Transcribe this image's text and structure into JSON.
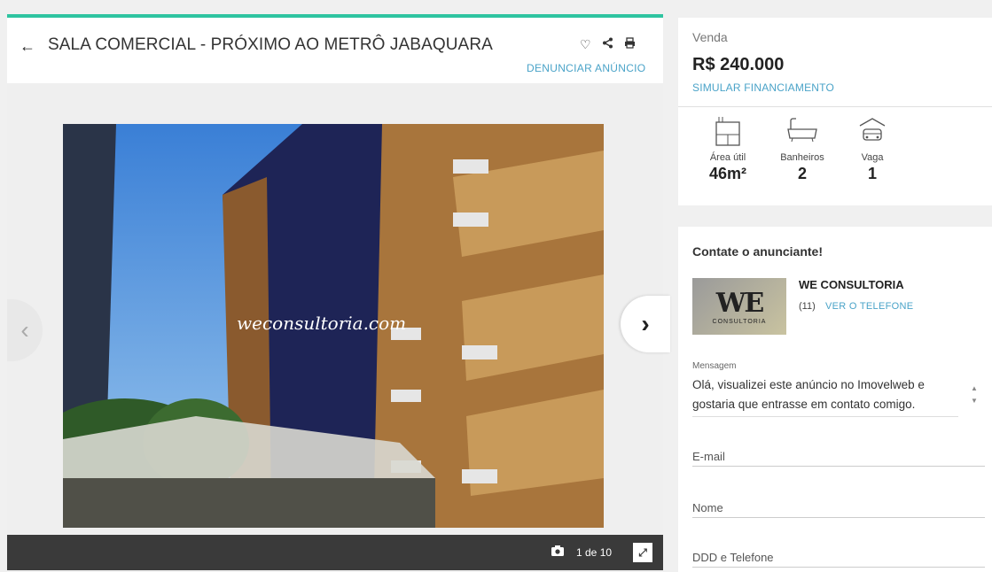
{
  "listing": {
    "title": "SALA COMERCIAL - PRÓXIMO AO METRÔ JABAQUARA",
    "report_label": "DENUNCIAR ANÚNCIO",
    "icons": [
      "heart-icon",
      "share-icon",
      "print-icon"
    ]
  },
  "gallery": {
    "watermark": "weconsultoria.com",
    "counter": "1 de 10",
    "current_photo": 1,
    "total_photos": 10
  },
  "pricing": {
    "type_label": "Venda",
    "price": "R$ 240.000",
    "financing_label": "SIMULAR FINANCIAMENTO"
  },
  "features": [
    {
      "icon": "area-icon",
      "label": "Área útil",
      "value": "46m²"
    },
    {
      "icon": "bathtub-icon",
      "label": "Banheiros",
      "value": "2"
    },
    {
      "icon": "car-icon",
      "label": "Vaga",
      "value": "1"
    }
  ],
  "contact": {
    "title": "Contate o anunciante!",
    "company": "WE CONSULTORIA",
    "logo_text": "WE",
    "logo_subtext": "CONSULTORIA",
    "phone_prefix": "(11)",
    "phone_button": "VER O TELEFONE",
    "message_label": "Mensagem",
    "message_value": "Olá, visualizei este anúncio no Imovelweb e gostaria que entrasse em contato comigo.",
    "email_placeholder": "E-mail",
    "name_placeholder": "Nome",
    "phone_placeholder": "DDD e Telefone"
  },
  "colors": {
    "accent_green": "#2ec4a0",
    "link_blue": "#4aa3c8",
    "gallery_bar": "#3a3a3a"
  }
}
